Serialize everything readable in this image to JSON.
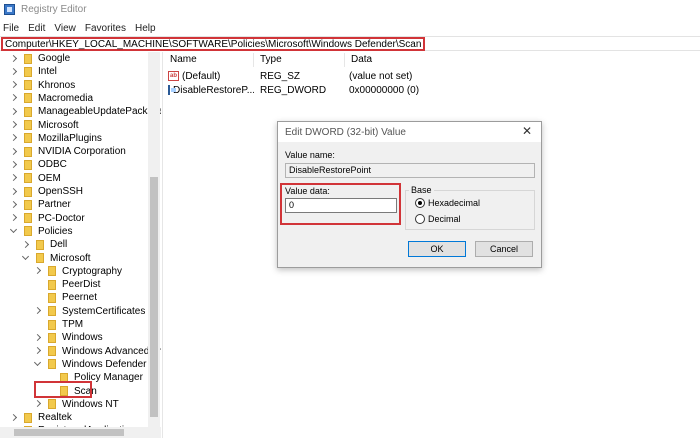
{
  "window": {
    "title": "Registry Editor"
  },
  "menu": [
    "File",
    "Edit",
    "View",
    "Favorites",
    "Help"
  ],
  "address": "Computer\\HKEY_LOCAL_MACHINE\\SOFTWARE\\Policies\\Microsoft\\Windows Defender\\Scan",
  "tree": [
    {
      "label": "Google",
      "level": 0,
      "state": "collapsed"
    },
    {
      "label": "Intel",
      "level": 0,
      "state": "collapsed"
    },
    {
      "label": "Khronos",
      "level": 0,
      "state": "collapsed"
    },
    {
      "label": "Macromedia",
      "level": 0,
      "state": "collapsed"
    },
    {
      "label": "ManageableUpdatePackage",
      "level": 0,
      "state": "collapsed"
    },
    {
      "label": "Microsoft",
      "level": 0,
      "state": "collapsed"
    },
    {
      "label": "MozillaPlugins",
      "level": 0,
      "state": "collapsed"
    },
    {
      "label": "NVIDIA Corporation",
      "level": 0,
      "state": "collapsed"
    },
    {
      "label": "ODBC",
      "level": 0,
      "state": "collapsed"
    },
    {
      "label": "OEM",
      "level": 0,
      "state": "collapsed"
    },
    {
      "label": "OpenSSH",
      "level": 0,
      "state": "collapsed"
    },
    {
      "label": "Partner",
      "level": 0,
      "state": "collapsed"
    },
    {
      "label": "PC-Doctor",
      "level": 0,
      "state": "collapsed"
    },
    {
      "label": "Policies",
      "level": 0,
      "state": "expanded"
    },
    {
      "label": "Dell",
      "level": 1,
      "state": "collapsed"
    },
    {
      "label": "Microsoft",
      "level": 1,
      "state": "expanded"
    },
    {
      "label": "Cryptography",
      "level": 2,
      "state": "collapsed"
    },
    {
      "label": "PeerDist",
      "level": 2,
      "state": "none"
    },
    {
      "label": "Peernet",
      "level": 2,
      "state": "none"
    },
    {
      "label": "SystemCertificates",
      "level": 2,
      "state": "collapsed"
    },
    {
      "label": "TPM",
      "level": 2,
      "state": "none"
    },
    {
      "label": "Windows",
      "level": 2,
      "state": "collapsed"
    },
    {
      "label": "Windows Advanced Th",
      "level": 2,
      "state": "collapsed"
    },
    {
      "label": "Windows Defender",
      "level": 2,
      "state": "expanded"
    },
    {
      "label": "Policy Manager",
      "level": 3,
      "state": "none"
    },
    {
      "label": "Scan",
      "level": 3,
      "state": "none"
    },
    {
      "label": "Windows NT",
      "level": 2,
      "state": "collapsed"
    },
    {
      "label": "Realtek",
      "level": 0,
      "state": "collapsed"
    },
    {
      "label": "RegisteredApplications",
      "level": 0,
      "state": "none"
    }
  ],
  "columns": {
    "name": "Name",
    "type": "Type",
    "data": "Data"
  },
  "values": [
    {
      "name": "(Default)",
      "type": "REG_SZ",
      "data": "(value not set)",
      "icon": "string-value-icon"
    },
    {
      "name": "DisableRestoreP...",
      "type": "REG_DWORD",
      "data": "0x00000000 (0)",
      "icon": "binary-value-icon"
    }
  ],
  "dialog": {
    "title": "Edit DWORD (32-bit) Value",
    "value_name_label": "Value name:",
    "value_name": "DisableRestorePoint",
    "value_data_label": "Value data:",
    "value_data": "0",
    "base_label": "Base",
    "hex_label": "Hexadecimal",
    "dec_label": "Decimal",
    "base_selected": "Hexadecimal",
    "ok_label": "OK",
    "cancel_label": "Cancel"
  }
}
